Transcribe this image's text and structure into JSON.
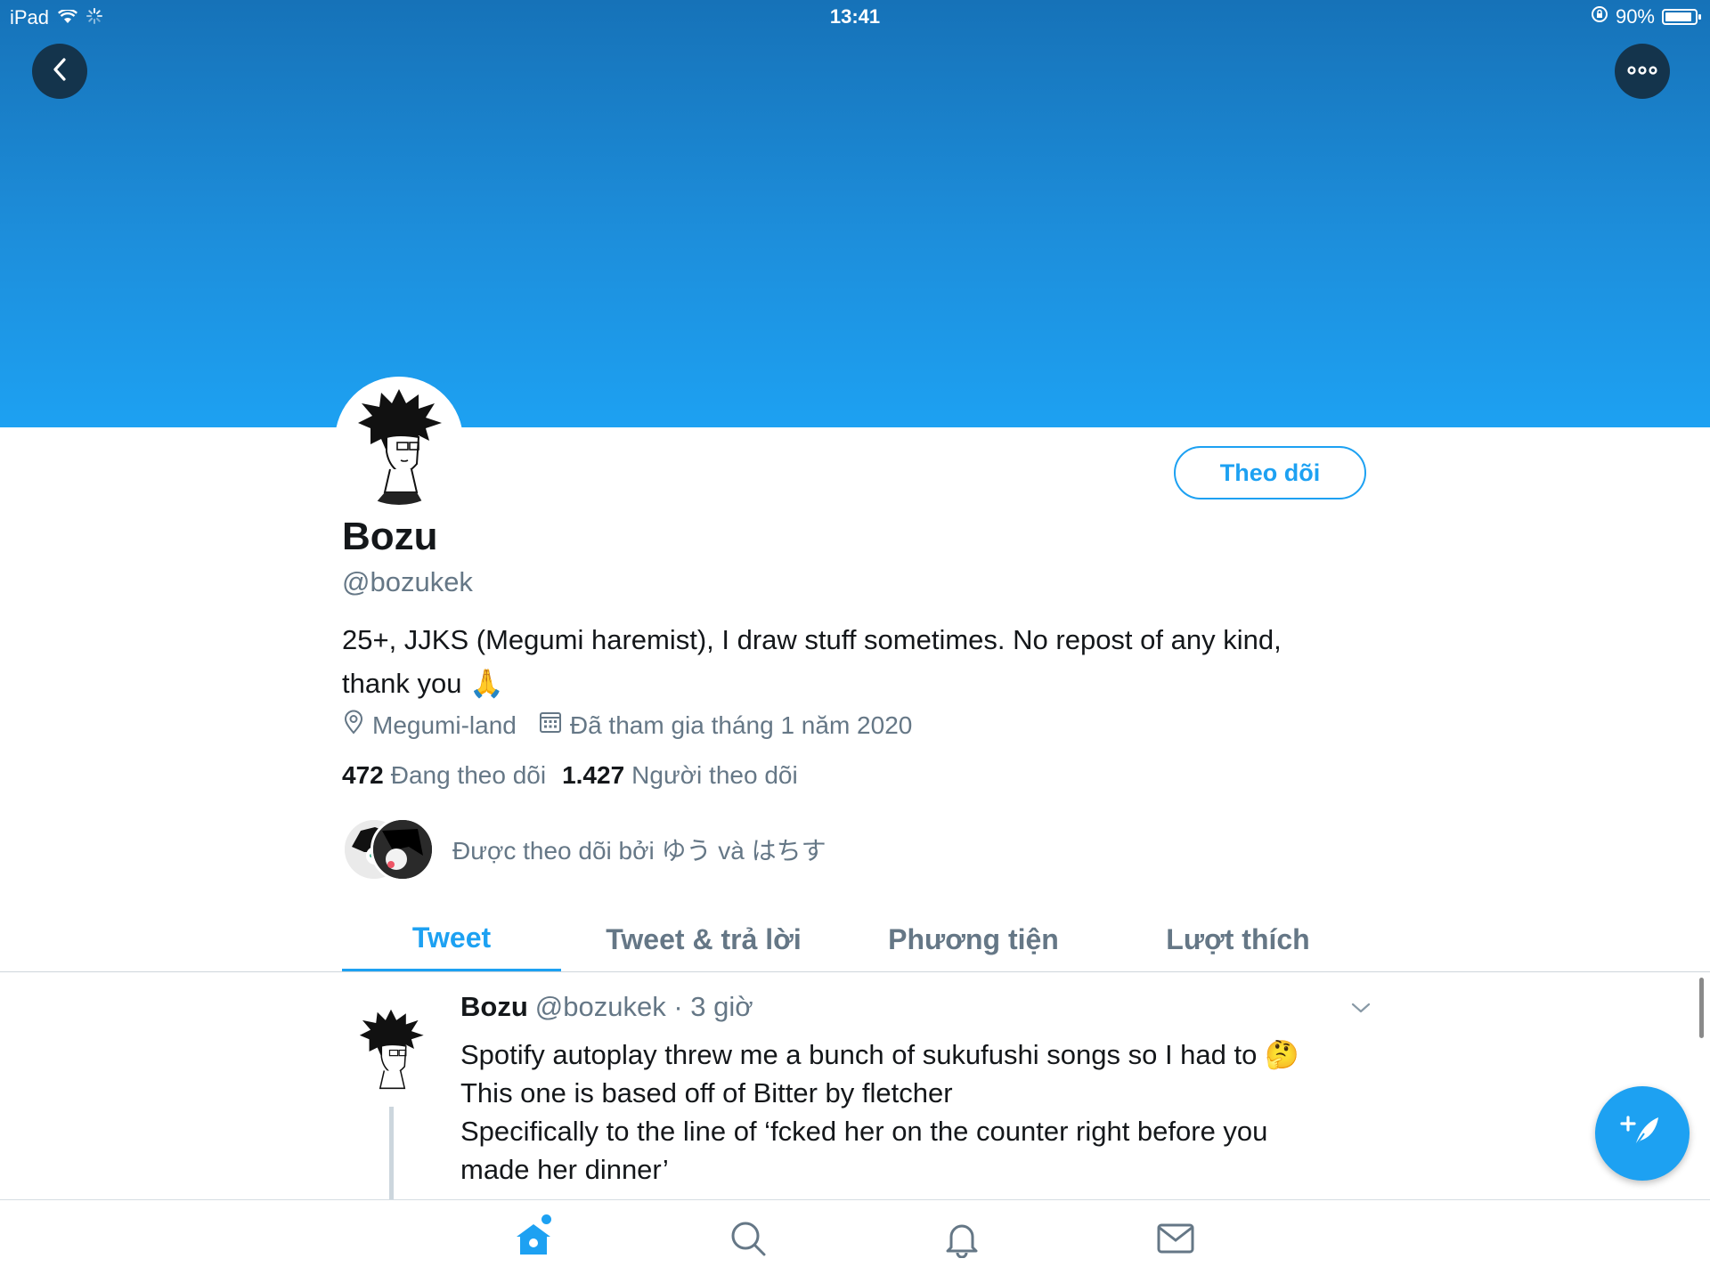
{
  "status_bar": {
    "device": "iPad",
    "time": "13:41",
    "battery": "90%",
    "battery_level": 0.9
  },
  "profile": {
    "name": "Bozu",
    "handle": "@bozukek",
    "bio_line1": "25+, JJKS (Megumi haremist), I draw stuff sometimes. No repost of any kind,",
    "bio_line2": "thank you 🙏",
    "location": "Megumi-land",
    "joined": "Đã tham gia tháng 1 năm 2020",
    "following_count": "472",
    "following_label": "Đang theo dõi",
    "followers_count": "1.427",
    "followers_label": "Người theo dõi",
    "followed_by": "Được theo dõi bởi ゆう và はちす",
    "follow_button": "Theo dõi"
  },
  "tabs": [
    {
      "label": "Tweet",
      "active": true
    },
    {
      "label": "Tweet & trả lời",
      "active": false
    },
    {
      "label": "Phương tiện",
      "active": false
    },
    {
      "label": "Lượt thích",
      "active": false
    }
  ],
  "tweet": {
    "name": "Bozu",
    "handle": "@bozukek",
    "time": "· 3 giờ",
    "line1": "Spotify autoplay threw me a bunch of sukufushi songs so I had to 🤔",
    "line2": "This one is based off of Bitter by fletcher",
    "line3": "Specifically to the line of ‘fcked her on the counter right before you",
    "line4": "made her dinner’"
  },
  "colors": {
    "accent": "#1da1f2",
    "banner_top": "#1672b8",
    "secondary_text": "#657786"
  },
  "icons": [
    "back-icon",
    "more-icon",
    "wifi-icon",
    "activity-spinner-icon",
    "rotation-lock-icon",
    "location-pin-icon",
    "calendar-icon",
    "chevron-down-icon",
    "compose-tweet-icon",
    "home-icon",
    "search-icon",
    "bell-icon",
    "mail-icon"
  ]
}
